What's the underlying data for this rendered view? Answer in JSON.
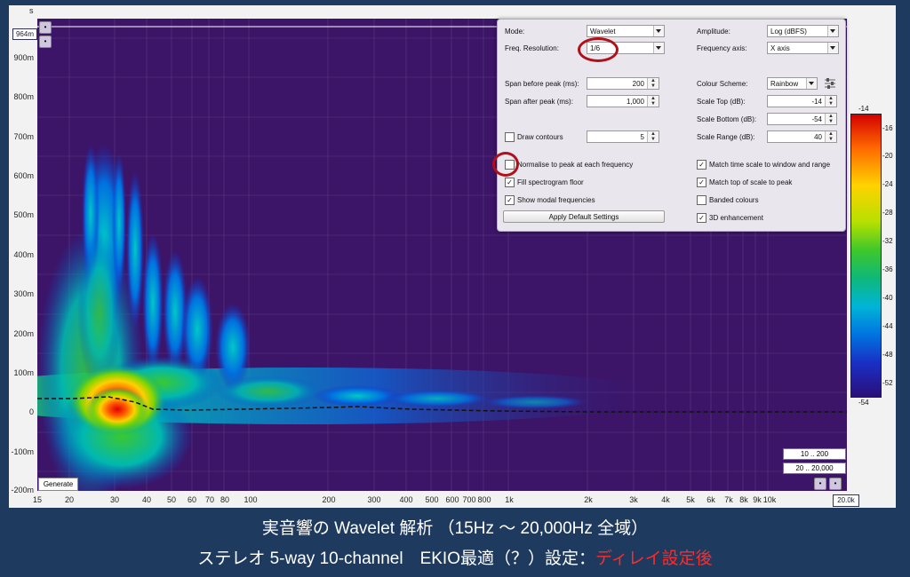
{
  "y_axis": {
    "unit": "s",
    "ticks": [
      "900m",
      "800m",
      "700m",
      "600m",
      "500m",
      "400m",
      "300m",
      "200m",
      "100m",
      "0",
      "-100m",
      "-200m"
    ],
    "cursor_value": "964m"
  },
  "x_axis": {
    "ticks": [
      "15",
      "20",
      "30",
      "40",
      "50",
      "60",
      "70",
      "80",
      "100",
      "200",
      "300",
      "400",
      "500",
      "600",
      "700",
      "800",
      "1k",
      "2k",
      "3k",
      "4k",
      "5k",
      "6k",
      "7k",
      "8k",
      "9k",
      "10k",
      "20.0k"
    ],
    "cursor_value": "20.0k"
  },
  "panel": {
    "mode_label": "Mode:",
    "mode_value": "Wavelet",
    "freq_res_label": "Freq. Resolution:",
    "freq_res_value": "1/6",
    "amplitude_label": "Amplitude:",
    "amplitude_value": "Log (dBFS)",
    "freq_axis_label": "Frequency axis:",
    "freq_axis_value": "X axis",
    "span_before_label": "Span before peak (ms):",
    "span_before_value": "200",
    "span_after_label": "Span after peak (ms):",
    "span_after_value": "1,000",
    "colour_scheme_label": "Colour Scheme:",
    "colour_scheme_value": "Rainbow",
    "scale_top_label": "Scale Top (dB):",
    "scale_top_value": "-14",
    "scale_bottom_label": "Scale Bottom (dB):",
    "scale_bottom_value": "-54",
    "scale_range_label": "Scale Range (dB):",
    "scale_range_value": "40",
    "draw_contours_label": "Draw contours",
    "draw_contours_value": "5",
    "draw_contours_checked": false,
    "normalise_label": "Normalise to peak at each frequency",
    "normalise_checked": false,
    "fill_floor_label": "Fill spectrogram floor",
    "fill_floor_checked": true,
    "show_modal_label": "Show modal frequencies",
    "show_modal_checked": true,
    "match_time_label": "Match time scale to window and range",
    "match_time_checked": true,
    "match_top_label": "Match top of scale to peak",
    "match_top_checked": true,
    "banded_label": "Banded colours",
    "banded_checked": false,
    "enhance3d_label": "3D enhancement",
    "enhance3d_checked": true,
    "apply_default_label": "Apply Default Settings",
    "check_mark": "✓"
  },
  "legend": {
    "ticks": [
      "-14",
      "-16",
      "-20",
      "-24",
      "-28",
      "-32",
      "-36",
      "-40",
      "-44",
      "-48",
      "-52",
      "-54"
    ]
  },
  "buttons": {
    "range_small": "10 .. 200",
    "range_large": "20 .. 20,000",
    "generate": "Generate"
  },
  "caption": {
    "line1": "実音響の Wavelet 解析 （15Hz ～ 20,000Hz 全域）",
    "line2_main": "ステレオ 5-way 10-channel　EKIO最適（？）設定：",
    "line2_highlight": "ディレイ設定後"
  },
  "colors": {
    "background": "#1f3a5f",
    "plot_bg": "#3c1468",
    "highlight_red": "#ff2a2a",
    "ring_red": "#b0101a"
  }
}
